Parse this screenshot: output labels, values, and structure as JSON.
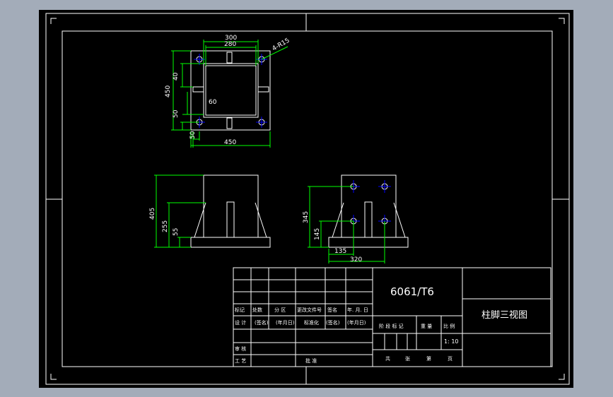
{
  "drawing": {
    "title": "柱脚三视图",
    "material": "6061/T6",
    "scale": "1: 10",
    "colors": {
      "background": "#000000",
      "frame": "#a3acb9",
      "geometry": "#ffffff",
      "dimensions": "#00ff00",
      "centerlines": "#0000ff"
    }
  },
  "top_view": {
    "dims": {
      "outer_width": "300",
      "inner_width": "280",
      "holes": "4-R15",
      "side_40": "40",
      "height_450": "450",
      "rib_60": "60",
      "side_50_vertical": "50",
      "side_50_horizontal": "50",
      "width_450": "450"
    }
  },
  "front_view": {
    "dims": {
      "overall_height": "405",
      "rib_height": "255",
      "slot_55": "55"
    }
  },
  "side_view": {
    "dims": {
      "height_345": "345",
      "height_145": "145",
      "offset_135": "135",
      "width_320": "320"
    }
  },
  "title_block": {
    "rev_headers": [
      "标记",
      "处数",
      "分 区",
      "更改文件号",
      "签名",
      "年. 月. 日"
    ],
    "design_row": [
      "设 计",
      "(签名)",
      "(年月日)",
      "标准化",
      "(签名)",
      "(年月日)"
    ],
    "review_label": "审 核",
    "process_label": "工 艺",
    "approve_label": "批 准",
    "stage_headers": [
      "阶 段 标 记",
      "重 量",
      "比 例"
    ],
    "sheet_row": [
      "共",
      "张",
      "第",
      "页"
    ]
  }
}
